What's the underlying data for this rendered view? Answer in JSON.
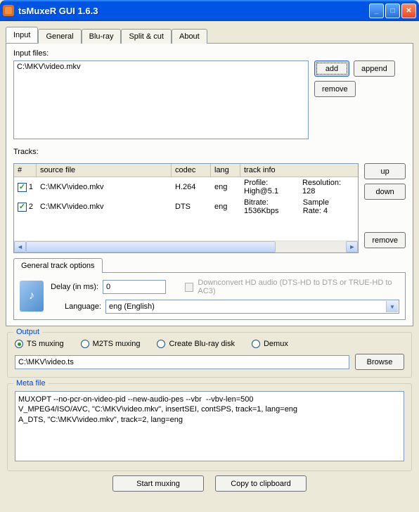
{
  "window": {
    "title": "tsMuxeR GUI 1.6.3"
  },
  "tabs": [
    "Input",
    "General",
    "Blu-ray",
    "Split & cut",
    "About"
  ],
  "active_tab": 0,
  "input_files": {
    "label": "Input files:",
    "files": [
      "C:\\MKV\\video.mkv"
    ],
    "add": "add",
    "append": "append",
    "remove": "remove"
  },
  "tracks": {
    "label": "Tracks:",
    "headers": {
      "num": "#",
      "src": "source file",
      "codec": "codec",
      "lang": "lang",
      "info": "track info"
    },
    "rows": [
      {
        "checked": true,
        "num": "1",
        "src": "C:\\MKV\\video.mkv",
        "codec": "H.264",
        "lang": "eng",
        "info1": "Profile: High@5.1",
        "info2": "Resolution: 128"
      },
      {
        "checked": true,
        "num": "2",
        "src": "C:\\MKV\\video.mkv",
        "codec": "DTS",
        "lang": "eng",
        "info1": "Bitrate: 1536Kbps",
        "info2": "Sample Rate: 4"
      }
    ],
    "up": "up",
    "down": "down",
    "remove": "remove"
  },
  "track_options": {
    "tab": "General track options",
    "delay_label": "Delay (in ms):",
    "delay_value": "0",
    "downconvert": "Downconvert HD audio (DTS-HD to DTS or TRUE-HD to AC3)",
    "language_label": "Language:",
    "language_value": "eng (English)"
  },
  "output": {
    "legend": "Output",
    "options": [
      "TS muxing",
      "M2TS muxing",
      "Create Blu-ray disk",
      "Demux"
    ],
    "selected": 0,
    "path": "C:\\MKV\\video.ts",
    "browse": "Browse"
  },
  "meta": {
    "legend": "Meta file",
    "text": "MUXOPT --no-pcr-on-video-pid --new-audio-pes --vbr  --vbv-len=500\nV_MPEG4/ISO/AVC, \"C:\\MKV\\video.mkv\", insertSEI, contSPS, track=1, lang=eng\nA_DTS, \"C:\\MKV\\video.mkv\", track=2, lang=eng"
  },
  "bottom": {
    "start": "Start muxing",
    "copy": "Copy to clipboard"
  }
}
